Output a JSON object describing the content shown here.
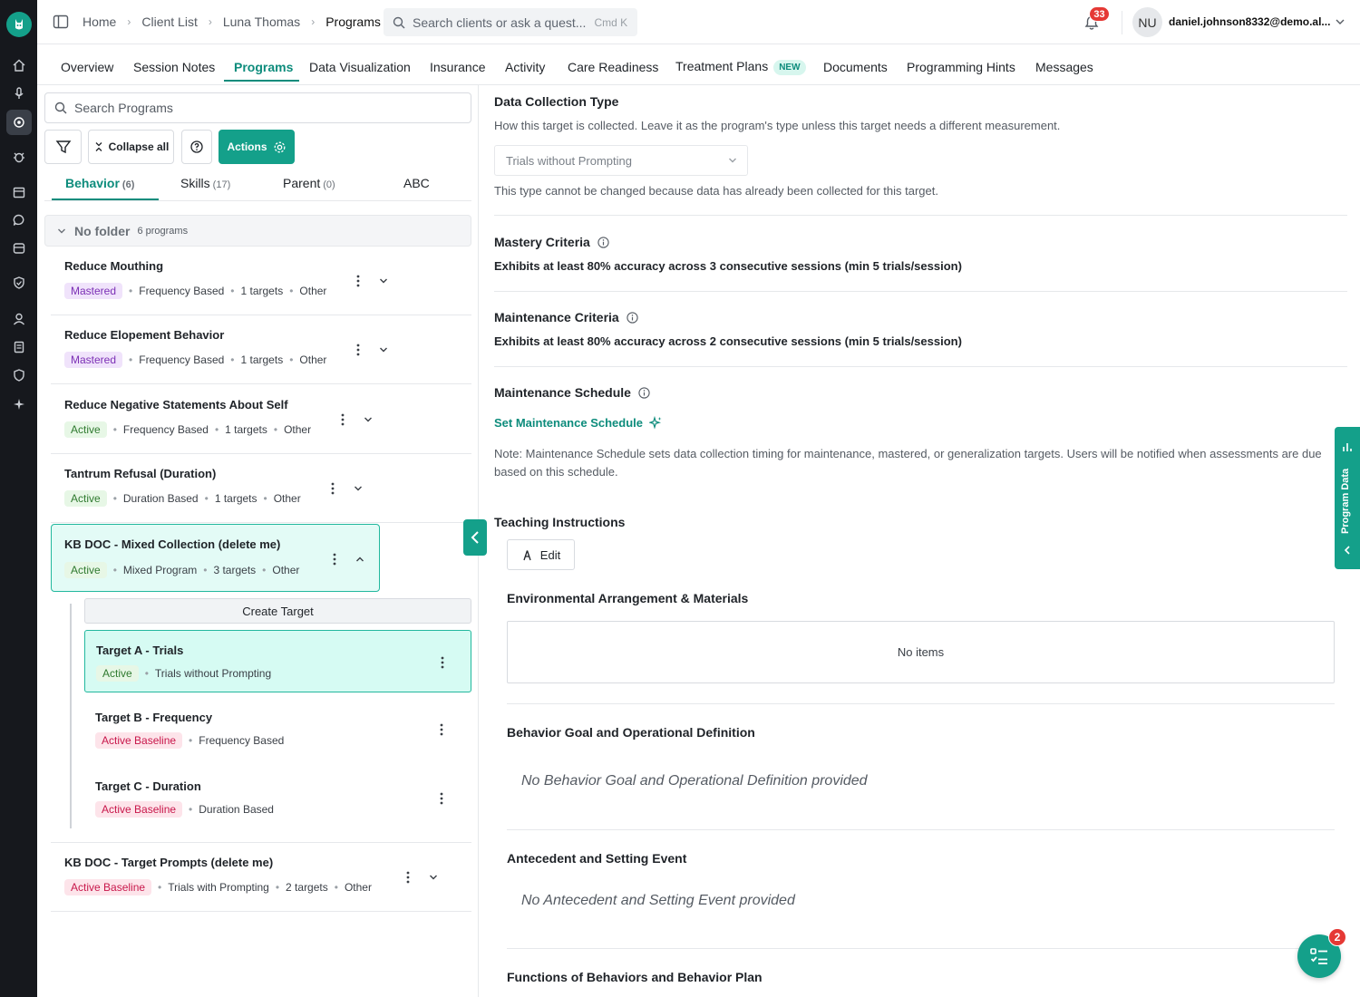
{
  "breadcrumbs": [
    "Home",
    "Client List",
    "Luna Thomas",
    "Programs"
  ],
  "search": {
    "placeholder": "Search clients or ask a quest...",
    "shortcut": "Cmd K"
  },
  "notifications": {
    "count": "33"
  },
  "user": {
    "initials": "NU",
    "email": "daniel.johnson8332@demo.al..."
  },
  "tabs": [
    {
      "label": "Overview"
    },
    {
      "label": "Session Notes"
    },
    {
      "label": "Programs"
    },
    {
      "label": "Data Visualization"
    },
    {
      "label": "Insurance"
    },
    {
      "label": "Activity"
    },
    {
      "label": "Care Readiness"
    },
    {
      "label": "Treatment Plans",
      "badge": "NEW"
    },
    {
      "label": "Documents"
    },
    {
      "label": "Programming Hints"
    },
    {
      "label": "Messages"
    }
  ],
  "left_panel": {
    "search_placeholder": "Search Programs",
    "collapse_all": "Collapse all",
    "actions": "Actions",
    "program_tabs": [
      {
        "label": "Behavior",
        "count": "(6)"
      },
      {
        "label": "Skills",
        "count": "(17)"
      },
      {
        "label": "Parent",
        "count": "(0)"
      },
      {
        "label": "ABC",
        "count": ""
      }
    ],
    "folder": {
      "name": "No folder",
      "count": "6 programs"
    },
    "programs": [
      {
        "title": "Reduce Mouthing",
        "status": "Mastered",
        "type": "Frequency Based",
        "targets": "1 targets",
        "category": "Other"
      },
      {
        "title": "Reduce Elopement Behavior",
        "status": "Mastered",
        "type": "Frequency Based",
        "targets": "1 targets",
        "category": "Other"
      },
      {
        "title": "Reduce Negative Statements About Self",
        "status": "Active",
        "type": "Frequency Based",
        "targets": "1 targets",
        "category": "Other"
      },
      {
        "title": "Tantrum Refusal (Duration)",
        "status": "Active",
        "type": "Duration Based",
        "targets": "1 targets",
        "category": "Other"
      },
      {
        "title": "KB DOC - Mixed Collection (delete me)",
        "status": "Active",
        "type": "Mixed Program",
        "targets": "3 targets",
        "category": "Other"
      },
      {
        "title": "KB DOC - Target Prompts (delete me)",
        "status": "Active Baseline",
        "type": "Trials with Prompting",
        "targets": "2 targets",
        "category": "Other"
      }
    ],
    "create_target": "Create Target",
    "targets": [
      {
        "title": "Target A - Trials",
        "status": "Active",
        "type": "Trials without Prompting"
      },
      {
        "title": "Target B - Frequency",
        "status": "Active Baseline",
        "type": "Frequency Based"
      },
      {
        "title": "Target C - Duration",
        "status": "Active Baseline",
        "type": "Duration Based"
      }
    ]
  },
  "detail": {
    "dct_title": "Data Collection Type",
    "dct_desc": "How this target is collected. Leave it as the program's type unless this target needs a different measurement.",
    "dct_value": "Trials without Prompting",
    "dct_note": "This type cannot be changed because data has already been collected for this target.",
    "mastery_title": "Mastery Criteria",
    "mastery_value": "Exhibits at least 80% accuracy across 3 consecutive sessions (min 5 trials/session)",
    "maint_title": "Maintenance Criteria",
    "maint_value": "Exhibits at least 80% accuracy across 2 consecutive sessions (min 5 trials/session)",
    "schedule_title": "Maintenance Schedule",
    "schedule_link": "Set Maintenance Schedule",
    "schedule_note": "Note: Maintenance Schedule sets data collection timing for maintenance, mastered, or generalization targets. Users will be notified when assessments are due based on this schedule.",
    "teaching_title": "Teaching Instructions",
    "edit": "Edit",
    "env_title": "Environmental Arrangement & Materials",
    "env_empty": "No items",
    "goal_title": "Behavior Goal and Operational Definition",
    "goal_empty": "No Behavior Goal and Operational Definition provided",
    "ante_title": "Antecedent and Setting Event",
    "ante_empty": "No Antecedent and Setting Event provided",
    "func_title": "Functions of Behaviors and Behavior Plan"
  },
  "drawer_label": "Program Data",
  "fab_badge": "2",
  "colors": {
    "accent": "#14a08a",
    "accent_text": "#0d8c7c",
    "rail": "#16181d",
    "badge": "#e53935"
  }
}
